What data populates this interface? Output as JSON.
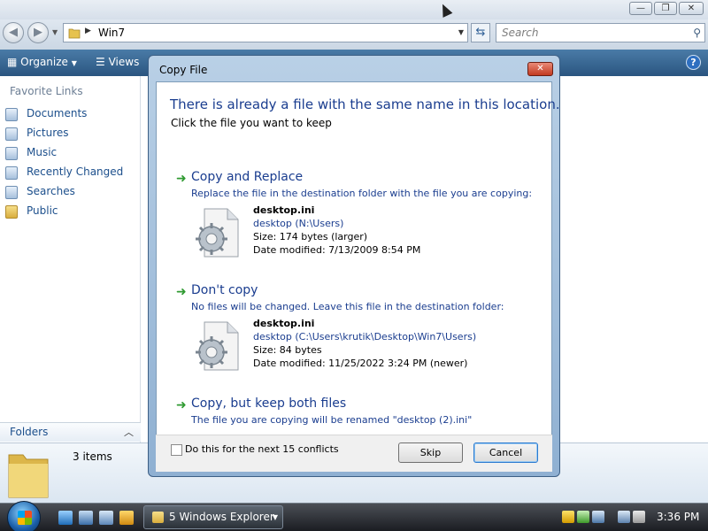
{
  "explorer": {
    "address_path": "Win7",
    "search_placeholder": "Search",
    "toolbar": {
      "organize_label": "Organize",
      "views_label": "Views",
      "help_symbol": "?"
    },
    "favorite_links_heading": "Favorite Links",
    "favorite_links": [
      {
        "label": "Documents",
        "icon": "documents-icon"
      },
      {
        "label": "Pictures",
        "icon": "pictures-icon"
      },
      {
        "label": "Music",
        "icon": "music-icon"
      },
      {
        "label": "Recently Changed",
        "icon": "recently-changed-icon"
      },
      {
        "label": "Searches",
        "icon": "searches-icon"
      },
      {
        "label": "Public",
        "icon": "folder-icon"
      }
    ],
    "folders_label": "Folders",
    "status_items": "3 items"
  },
  "dialog": {
    "title": "Copy File",
    "heading": "There is already a file with the same name in this location.",
    "subheading": "Click the file you want to keep",
    "options": [
      {
        "title": "Copy and Replace",
        "description": "Replace the file in the destination folder with the file you are copying:",
        "file": {
          "name": "desktop.ini",
          "path": "desktop (N:\\Users)",
          "size": "Size: 174 bytes (larger)",
          "date": "Date modified: 7/13/2009 8:54 PM"
        }
      },
      {
        "title": "Don't copy",
        "description": "No files will be changed. Leave this file in the destination folder:",
        "file": {
          "name": "desktop.ini",
          "path": "desktop (C:\\Users\\krutik\\Desktop\\Win7\\Users)",
          "size": "Size: 84 bytes",
          "date": "Date modified: 11/25/2022 3:24 PM (newer)"
        }
      },
      {
        "title": "Copy, but keep both files",
        "description": "The file you are copying will be renamed \"desktop (2).ini\""
      }
    ],
    "checkbox_label": "Do this for the next 15 conflicts",
    "skip_label": "Skip",
    "cancel_label": "Cancel"
  },
  "taskbar": {
    "task_label": "5 Windows Explorer",
    "clock": "3:36 PM"
  }
}
